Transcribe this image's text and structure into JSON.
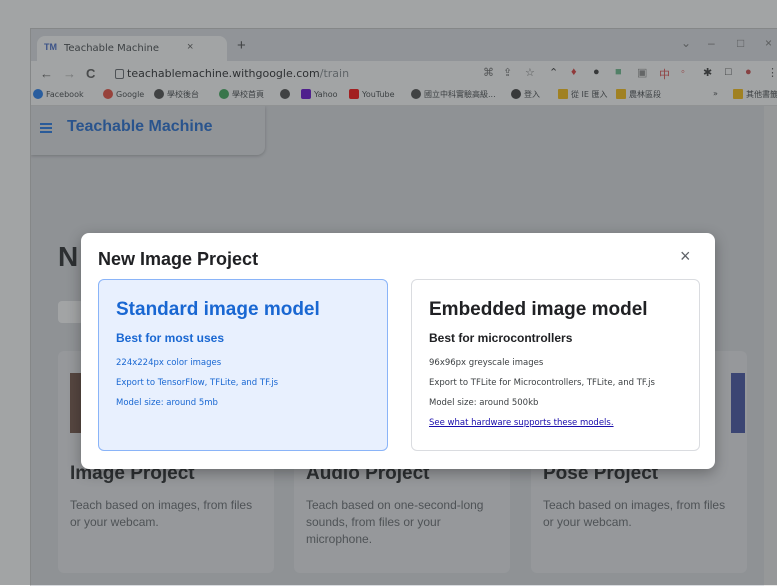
{
  "browser": {
    "tab_favicon": "TM",
    "tab_title": "Teachable Machine",
    "tab_close": "×",
    "new_tab": "+",
    "window_controls": [
      "⌄",
      "–",
      "□",
      "×"
    ],
    "nav": {
      "back": "←",
      "forward": "→",
      "reload": "C"
    },
    "url_domain": "teachablemachine.withgoogle.com",
    "url_path": "/train",
    "bookmarks": [
      {
        "label": "Facebook",
        "color": "#1877f2"
      },
      {
        "label": "Google",
        "color": "#ea4335"
      },
      {
        "label": "學校後台",
        "color": "#444444"
      },
      {
        "label": "學校首頁",
        "color": "#34a853"
      },
      {
        "label": "",
        "color": "#444444"
      },
      {
        "label": "Yahoo",
        "color": "#6001d2"
      },
      {
        "label": "YouTube",
        "color": "#ff0000"
      },
      {
        "label": "國立中科實驗高級...",
        "color": "#444444"
      },
      {
        "label": "登入",
        "color": "#333333"
      },
      {
        "label": "從 IE 匯入",
        "color": "#fbbc04"
      },
      {
        "label": "農林區段",
        "color": "#fbbc04"
      },
      {
        "label": "»",
        "color": ""
      },
      {
        "label": "其他書籤",
        "color": "#fbbc04"
      }
    ]
  },
  "app": {
    "title": "Teachable Machine",
    "background_heading_letter": "N"
  },
  "projects": [
    {
      "title": "Image Project",
      "description": "Teach based on images, from files or your webcam."
    },
    {
      "title": "Audio Project",
      "description": "Teach based on one-second-long sounds, from files or your microphone."
    },
    {
      "title": "Pose Project",
      "description": "Teach based on images, from files or your webcam."
    }
  ],
  "modal": {
    "title": "New Image Project",
    "close": "×",
    "options": [
      {
        "title": "Standard image model",
        "subtitle": "Best for most uses",
        "lines": [
          "224x224px color images",
          "Export to TensorFlow, TFLite, and TF.js",
          "Model size: around 5mb"
        ],
        "selected": true
      },
      {
        "title": "Embedded image model",
        "subtitle": "Best for microcontrollers",
        "lines": [
          "96x96px greyscale images",
          "Export to TFLite for Microcontrollers, TFLite, and TF.js",
          "Model size: around 500kb"
        ],
        "link": "See what hardware supports these models."
      }
    ]
  },
  "colors": {
    "accent": "#1967d2",
    "selected_bg": "#e8f0fe"
  }
}
